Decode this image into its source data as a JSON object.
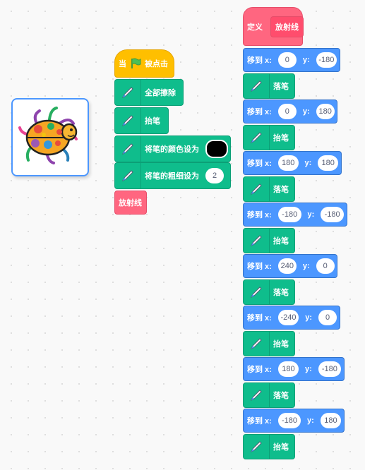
{
  "sprite": {
    "name": "beetle"
  },
  "script1": {
    "when_label": "当",
    "clicked_label": "被点击",
    "erase_label": "全部擦除",
    "pen_up_label": "抬笔",
    "set_color_label": "将笔的颜色设为",
    "set_color_value": "#000000",
    "set_size_label": "将笔的粗细设为",
    "set_size_value": "2",
    "call_label": "放射线"
  },
  "script2": {
    "define_label": "定义",
    "define_name": "放射线",
    "goto_label": "移到 x:",
    "y_label": "y:",
    "pen_down_label": "落笔",
    "pen_up_label": "抬笔",
    "moves": [
      {
        "x": "0",
        "y": "-180"
      },
      {
        "x": "0",
        "y": "180"
      },
      {
        "x": "180",
        "y": "180"
      },
      {
        "x": "-180",
        "y": "-180"
      },
      {
        "x": "240",
        "y": "0"
      },
      {
        "x": "-240",
        "y": "0"
      },
      {
        "x": "180",
        "y": "-180"
      },
      {
        "x": "-180",
        "y": "180"
      }
    ]
  },
  "colors": {
    "pen": "#0fbd8c",
    "motion": "#4c97ff",
    "custom": "#ff6680",
    "event": "#ffbf00"
  }
}
